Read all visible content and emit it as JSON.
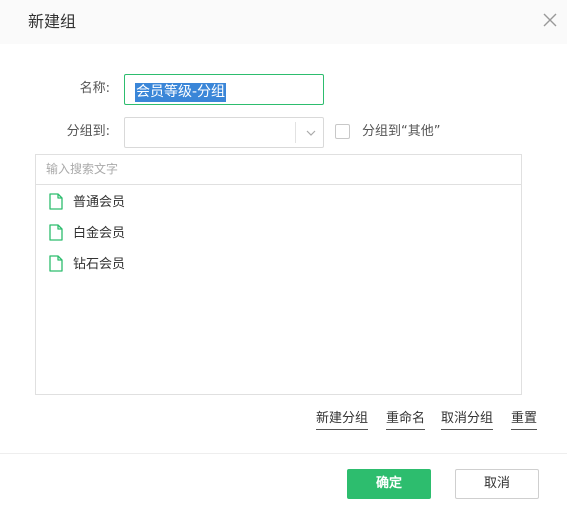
{
  "dialog": {
    "title": "新建组",
    "close_icon": "close-icon"
  },
  "form": {
    "name_label": "名称:",
    "name_value": "会员等级-分组",
    "group_label": "分组到:",
    "group_value": "",
    "group_dropdown_icon": "chevron-down-icon",
    "other_checkbox_checked": false,
    "other_checkbox_label": "分组到“其他”"
  },
  "list": {
    "search_placeholder": "输入搜索文字",
    "item_icon": "file-icon",
    "items": [
      {
        "label": "普通会员"
      },
      {
        "label": "白金会员"
      },
      {
        "label": "钻石会员"
      }
    ]
  },
  "actions": {
    "new_group": "新建分组",
    "rename": "重命名",
    "ungroup": "取消分组",
    "reset": "重置"
  },
  "footer": {
    "ok_label": "确定",
    "cancel_label": "取消"
  },
  "colors": {
    "accent": "#2dbd6e",
    "selection": "#3a86d8",
    "header_bg": "#fafafa"
  }
}
